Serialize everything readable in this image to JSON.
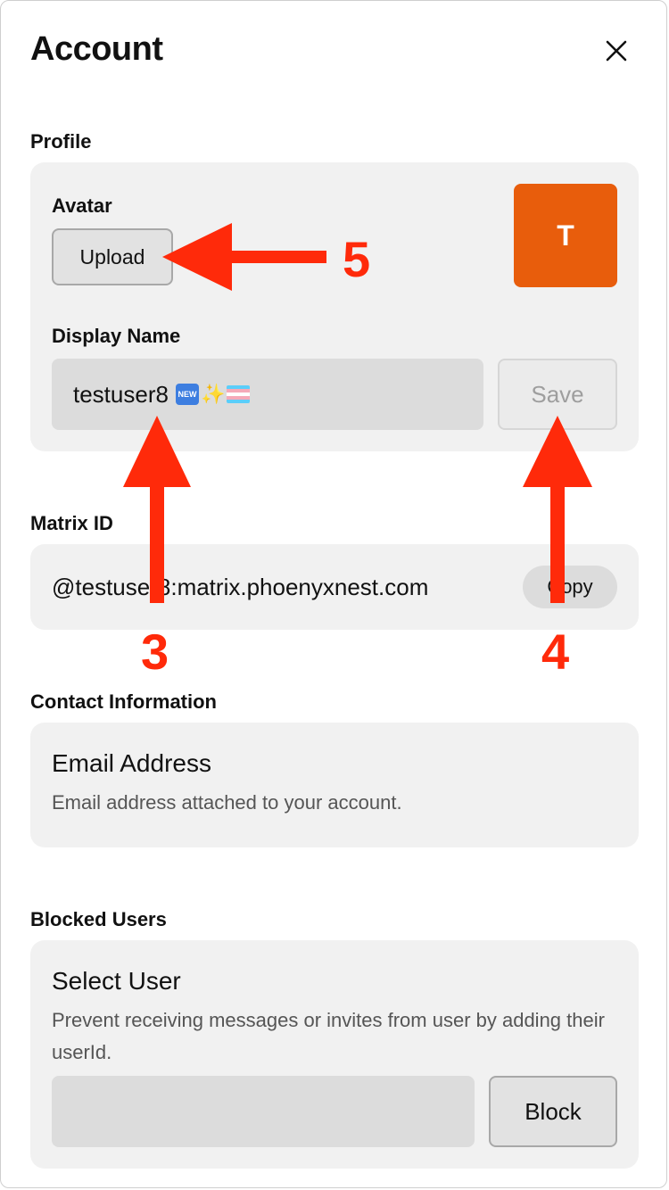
{
  "header": {
    "title": "Account"
  },
  "profile": {
    "section_label": "Profile",
    "avatar_label": "Avatar",
    "upload_label": "Upload",
    "avatar_initial": "T",
    "avatar_color": "#E85D0C",
    "display_name_label": "Display Name",
    "display_name_value": "testuser8",
    "display_name_emoji": [
      "new-button-emoji",
      "sparkles-emoji",
      "transgender-flag-emoji"
    ],
    "save_label": "Save"
  },
  "matrix": {
    "section_label": "Matrix ID",
    "id_value": "@testuser8:matrix.phoenyxnest.com",
    "copy_label": "Copy"
  },
  "contact": {
    "section_label": "Contact Information",
    "title": "Email Address",
    "description": "Email address attached to your account."
  },
  "blocked": {
    "section_label": "Blocked Users",
    "title": "Select User",
    "description": "Prevent receiving messages or invites from user by adding their userId.",
    "input_value": "",
    "block_label": "Block"
  },
  "annotations": {
    "marker_3": "3",
    "marker_4": "4",
    "marker_5": "5",
    "color": "#FF2A0A"
  }
}
